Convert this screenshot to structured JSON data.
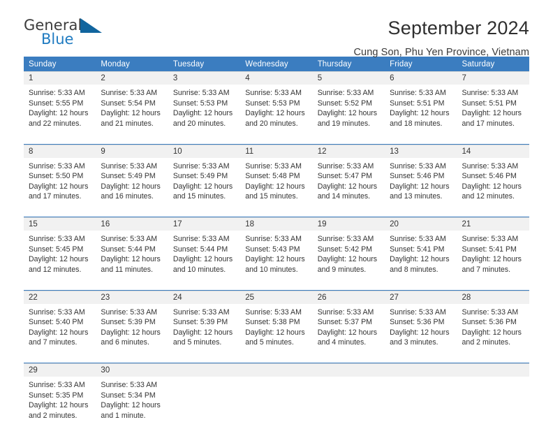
{
  "brand": {
    "name_part1": "General",
    "name_part2": "Blue",
    "triangle_color": "#11659e",
    "blue_color": "#1f7bc1"
  },
  "header": {
    "title": "September 2024",
    "subtitle": "Cung Son, Phu Yen Province, Vietnam"
  },
  "calendar": {
    "header_bg": "#3b7dc0",
    "daynum_bg": "#f1f1f1",
    "weekdays": [
      "Sunday",
      "Monday",
      "Tuesday",
      "Wednesday",
      "Thursday",
      "Friday",
      "Saturday"
    ],
    "weeks": [
      [
        {
          "day": "1",
          "sunrise": "Sunrise: 5:33 AM",
          "sunset": "Sunset: 5:55 PM",
          "daylight1": "Daylight: 12 hours",
          "daylight2": "and 22 minutes."
        },
        {
          "day": "2",
          "sunrise": "Sunrise: 5:33 AM",
          "sunset": "Sunset: 5:54 PM",
          "daylight1": "Daylight: 12 hours",
          "daylight2": "and 21 minutes."
        },
        {
          "day": "3",
          "sunrise": "Sunrise: 5:33 AM",
          "sunset": "Sunset: 5:53 PM",
          "daylight1": "Daylight: 12 hours",
          "daylight2": "and 20 minutes."
        },
        {
          "day": "4",
          "sunrise": "Sunrise: 5:33 AM",
          "sunset": "Sunset: 5:53 PM",
          "daylight1": "Daylight: 12 hours",
          "daylight2": "and 20 minutes."
        },
        {
          "day": "5",
          "sunrise": "Sunrise: 5:33 AM",
          "sunset": "Sunset: 5:52 PM",
          "daylight1": "Daylight: 12 hours",
          "daylight2": "and 19 minutes."
        },
        {
          "day": "6",
          "sunrise": "Sunrise: 5:33 AM",
          "sunset": "Sunset: 5:51 PM",
          "daylight1": "Daylight: 12 hours",
          "daylight2": "and 18 minutes."
        },
        {
          "day": "7",
          "sunrise": "Sunrise: 5:33 AM",
          "sunset": "Sunset: 5:51 PM",
          "daylight1": "Daylight: 12 hours",
          "daylight2": "and 17 minutes."
        }
      ],
      [
        {
          "day": "8",
          "sunrise": "Sunrise: 5:33 AM",
          "sunset": "Sunset: 5:50 PM",
          "daylight1": "Daylight: 12 hours",
          "daylight2": "and 17 minutes."
        },
        {
          "day": "9",
          "sunrise": "Sunrise: 5:33 AM",
          "sunset": "Sunset: 5:49 PM",
          "daylight1": "Daylight: 12 hours",
          "daylight2": "and 16 minutes."
        },
        {
          "day": "10",
          "sunrise": "Sunrise: 5:33 AM",
          "sunset": "Sunset: 5:49 PM",
          "daylight1": "Daylight: 12 hours",
          "daylight2": "and 15 minutes."
        },
        {
          "day": "11",
          "sunrise": "Sunrise: 5:33 AM",
          "sunset": "Sunset: 5:48 PM",
          "daylight1": "Daylight: 12 hours",
          "daylight2": "and 15 minutes."
        },
        {
          "day": "12",
          "sunrise": "Sunrise: 5:33 AM",
          "sunset": "Sunset: 5:47 PM",
          "daylight1": "Daylight: 12 hours",
          "daylight2": "and 14 minutes."
        },
        {
          "day": "13",
          "sunrise": "Sunrise: 5:33 AM",
          "sunset": "Sunset: 5:46 PM",
          "daylight1": "Daylight: 12 hours",
          "daylight2": "and 13 minutes."
        },
        {
          "day": "14",
          "sunrise": "Sunrise: 5:33 AM",
          "sunset": "Sunset: 5:46 PM",
          "daylight1": "Daylight: 12 hours",
          "daylight2": "and 12 minutes."
        }
      ],
      [
        {
          "day": "15",
          "sunrise": "Sunrise: 5:33 AM",
          "sunset": "Sunset: 5:45 PM",
          "daylight1": "Daylight: 12 hours",
          "daylight2": "and 12 minutes."
        },
        {
          "day": "16",
          "sunrise": "Sunrise: 5:33 AM",
          "sunset": "Sunset: 5:44 PM",
          "daylight1": "Daylight: 12 hours",
          "daylight2": "and 11 minutes."
        },
        {
          "day": "17",
          "sunrise": "Sunrise: 5:33 AM",
          "sunset": "Sunset: 5:44 PM",
          "daylight1": "Daylight: 12 hours",
          "daylight2": "and 10 minutes."
        },
        {
          "day": "18",
          "sunrise": "Sunrise: 5:33 AM",
          "sunset": "Sunset: 5:43 PM",
          "daylight1": "Daylight: 12 hours",
          "daylight2": "and 10 minutes."
        },
        {
          "day": "19",
          "sunrise": "Sunrise: 5:33 AM",
          "sunset": "Sunset: 5:42 PM",
          "daylight1": "Daylight: 12 hours",
          "daylight2": "and 9 minutes."
        },
        {
          "day": "20",
          "sunrise": "Sunrise: 5:33 AM",
          "sunset": "Sunset: 5:41 PM",
          "daylight1": "Daylight: 12 hours",
          "daylight2": "and 8 minutes."
        },
        {
          "day": "21",
          "sunrise": "Sunrise: 5:33 AM",
          "sunset": "Sunset: 5:41 PM",
          "daylight1": "Daylight: 12 hours",
          "daylight2": "and 7 minutes."
        }
      ],
      [
        {
          "day": "22",
          "sunrise": "Sunrise: 5:33 AM",
          "sunset": "Sunset: 5:40 PM",
          "daylight1": "Daylight: 12 hours",
          "daylight2": "and 7 minutes."
        },
        {
          "day": "23",
          "sunrise": "Sunrise: 5:33 AM",
          "sunset": "Sunset: 5:39 PM",
          "daylight1": "Daylight: 12 hours",
          "daylight2": "and 6 minutes."
        },
        {
          "day": "24",
          "sunrise": "Sunrise: 5:33 AM",
          "sunset": "Sunset: 5:39 PM",
          "daylight1": "Daylight: 12 hours",
          "daylight2": "and 5 minutes."
        },
        {
          "day": "25",
          "sunrise": "Sunrise: 5:33 AM",
          "sunset": "Sunset: 5:38 PM",
          "daylight1": "Daylight: 12 hours",
          "daylight2": "and 5 minutes."
        },
        {
          "day": "26",
          "sunrise": "Sunrise: 5:33 AM",
          "sunset": "Sunset: 5:37 PM",
          "daylight1": "Daylight: 12 hours",
          "daylight2": "and 4 minutes."
        },
        {
          "day": "27",
          "sunrise": "Sunrise: 5:33 AM",
          "sunset": "Sunset: 5:36 PM",
          "daylight1": "Daylight: 12 hours",
          "daylight2": "and 3 minutes."
        },
        {
          "day": "28",
          "sunrise": "Sunrise: 5:33 AM",
          "sunset": "Sunset: 5:36 PM",
          "daylight1": "Daylight: 12 hours",
          "daylight2": "and 2 minutes."
        }
      ],
      [
        {
          "day": "29",
          "sunrise": "Sunrise: 5:33 AM",
          "sunset": "Sunset: 5:35 PM",
          "daylight1": "Daylight: 12 hours",
          "daylight2": "and 2 minutes."
        },
        {
          "day": "30",
          "sunrise": "Sunrise: 5:33 AM",
          "sunset": "Sunset: 5:34 PM",
          "daylight1": "Daylight: 12 hours",
          "daylight2": "and 1 minute."
        },
        {
          "day": "",
          "sunrise": "",
          "sunset": "",
          "daylight1": "",
          "daylight2": ""
        },
        {
          "day": "",
          "sunrise": "",
          "sunset": "",
          "daylight1": "",
          "daylight2": ""
        },
        {
          "day": "",
          "sunrise": "",
          "sunset": "",
          "daylight1": "",
          "daylight2": ""
        },
        {
          "day": "",
          "sunrise": "",
          "sunset": "",
          "daylight1": "",
          "daylight2": ""
        },
        {
          "day": "",
          "sunrise": "",
          "sunset": "",
          "daylight1": "",
          "daylight2": ""
        }
      ]
    ]
  }
}
